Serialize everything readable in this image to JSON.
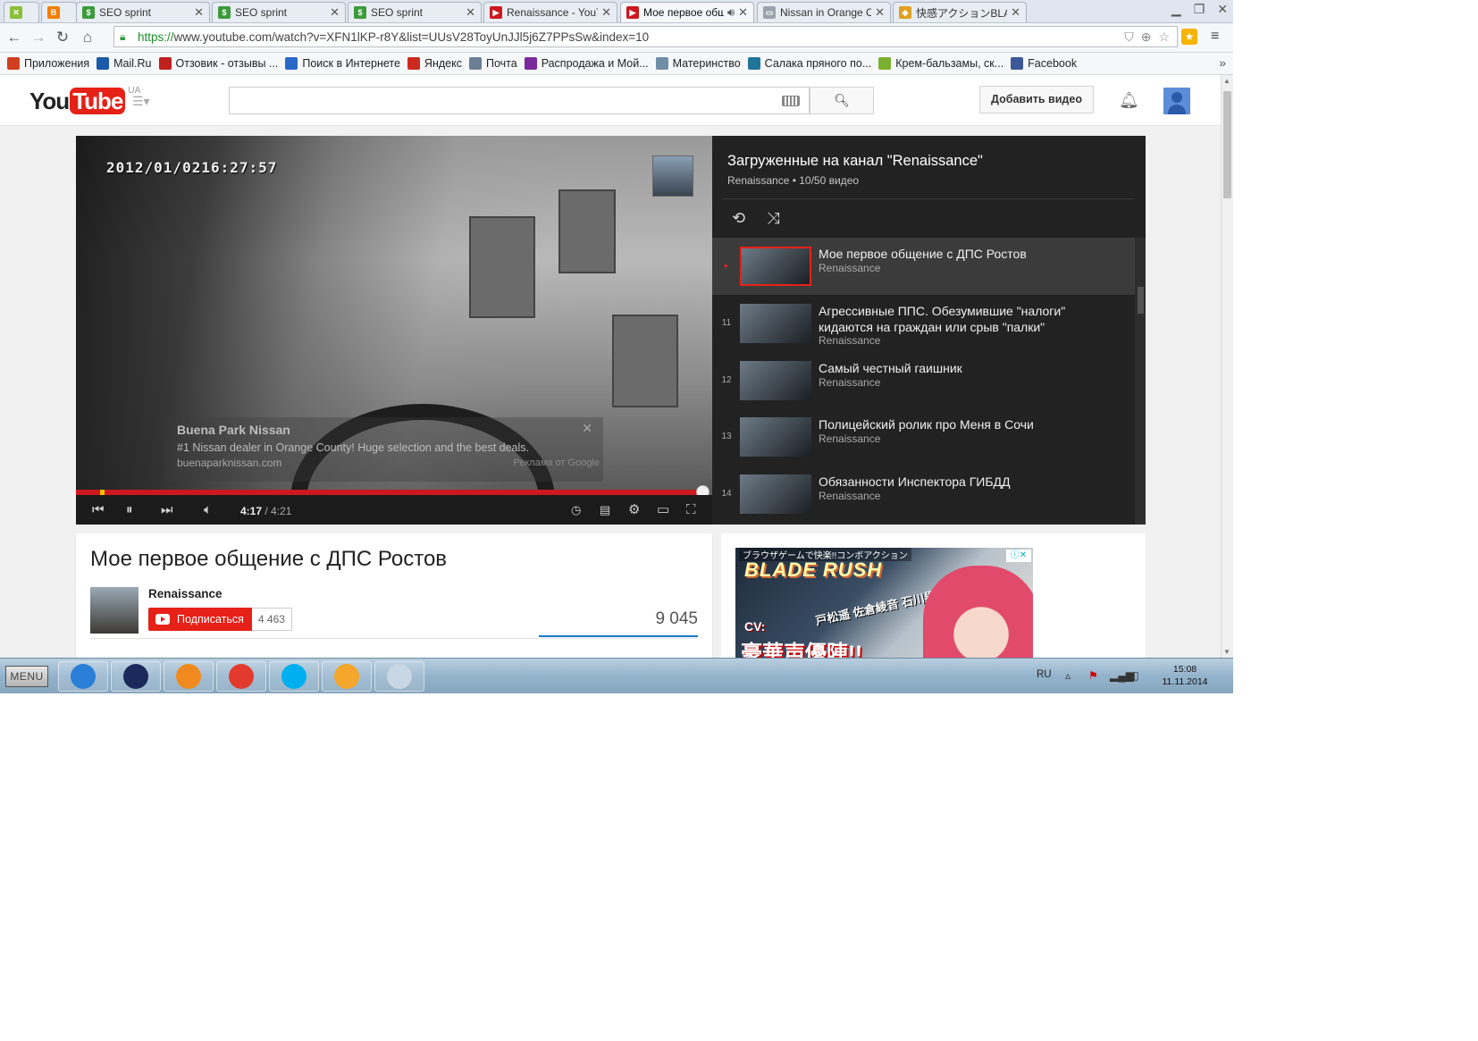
{
  "tabs": [
    {
      "title": "",
      "icon": "app-icon",
      "color": "#8bbf3a",
      "active": false
    },
    {
      "title": "",
      "icon": "blogger-icon",
      "color": "#f57d00",
      "active": false
    },
    {
      "title": "SEO sprint",
      "icon": "seosprint-icon",
      "color": "#3c9a3c",
      "active": false
    },
    {
      "title": "SEO sprint",
      "icon": "seosprint-icon",
      "color": "#3c9a3c",
      "active": false
    },
    {
      "title": "SEO sprint",
      "icon": "seosprint-icon",
      "color": "#3c9a3c",
      "active": false
    },
    {
      "title": "Renaissance - YouTu",
      "icon": "youtube-icon",
      "color": "#cc181e",
      "active": false
    },
    {
      "title": "Мое первое обш",
      "icon": "youtube-icon",
      "color": "#cc181e",
      "active": true,
      "audio": "speaker-icon"
    },
    {
      "title": "Nissan in Orange Co",
      "icon": "page-icon",
      "color": "#9aa3ad",
      "active": false
    },
    {
      "title": "快感アクションBLAD",
      "icon": "game-icon",
      "color": "#e0a020",
      "active": false
    }
  ],
  "browser": {
    "url_proto": "https://",
    "url_rest": "www.youtube.com/watch?v=XFN1lKP-r8Y&list=UUsV28ToyUnJJl5j6Z7PPsSw&index=10"
  },
  "bookmarks": [
    {
      "label": "Приложения",
      "icon": "apps-grid-icon",
      "color": "#d04020"
    },
    {
      "label": "Mail.Ru",
      "icon": "mailru-icon",
      "color": "#1a5aa8"
    },
    {
      "label": "Отзовик - отзывы ...",
      "icon": "otzovik-icon",
      "color": "#c02020"
    },
    {
      "label": "Поиск в Интернете",
      "icon": "search-icon",
      "color": "#2a68c8"
    },
    {
      "label": "Яндекс",
      "icon": "yandex-icon",
      "color": "#cc2a1e"
    },
    {
      "label": "Почта",
      "icon": "mail-icon",
      "color": "#6c7e96"
    },
    {
      "label": "Распродажа и Мой...",
      "icon": "sale-icon",
      "color": "#7a2a9a"
    },
    {
      "label": "Материнство",
      "icon": "mother-icon",
      "color": "#6f8ea8"
    },
    {
      "label": "Салака пряного по...",
      "icon": "wordpress-icon",
      "color": "#21759b"
    },
    {
      "label": "Крем-бальзамы, ск...",
      "icon": "leaf-icon",
      "color": "#7ab030"
    },
    {
      "label": "Facebook",
      "icon": "facebook-icon",
      "color": "#3b5998"
    }
  ],
  "yt": {
    "logo_you": "You",
    "logo_tube": "Tube",
    "region": "UA",
    "search_placeholder": "",
    "upload_label": "Добавить видео"
  },
  "player": {
    "timestamp": "2012/01/0216:27:57",
    "current_time": "4:17",
    "separator": " / ",
    "duration": "4:21",
    "played_fraction": 0.984,
    "ad": {
      "title": "Buena Park Nissan",
      "description": "#1 Nissan dealer in Orange County! Huge selection and the best deals.",
      "url": "buenaparknissan.com",
      "attribution": "Реклама от Google",
      "close": "✕"
    }
  },
  "playlist": {
    "title": "Загруженные на канал \"Renaissance\"",
    "subtitle": "Renaissance • 10/50 видео",
    "items": [
      {
        "index": "▸",
        "title": "Мое первое общение с ДПС Ростов",
        "owner": "Renaissance",
        "active": true
      },
      {
        "index": "11",
        "title": "Агрессивные ППС. Обезумившие \"налоги\" кидаются на граждан или срыв \"палки\"",
        "owner": "Renaissance",
        "active": false
      },
      {
        "index": "12",
        "title": "Самый честный гаишник",
        "owner": "Renaissance",
        "active": false
      },
      {
        "index": "13",
        "title": "Полицейский ролик про Меня в Сочи",
        "owner": "Renaissance",
        "active": false
      },
      {
        "index": "14",
        "title": "Обязанности Инспектора ГИБДД",
        "owner": "Renaissance",
        "active": false
      }
    ]
  },
  "video": {
    "title": "Мое первое общение с ДПС Ростов",
    "owner": "Renaissance",
    "subscribe_label": "Подписаться",
    "subscriber_count": "4 463",
    "view_count": "9 045"
  },
  "ad_banner": {
    "top_line": "ブラウザゲームで快楽!!コンボアクション",
    "brand": "BLADE RUSH",
    "names": "戸松遥 佐倉綾音 石川界人",
    "cast": "CV:",
    "catch": "豪華声優陣!!"
  },
  "taskbar": {
    "start_label": "MENU",
    "apps": [
      {
        "name": "ie-icon",
        "color": "#2a7fd8"
      },
      {
        "name": "monitor-icon",
        "color": "#1b2a5a"
      },
      {
        "name": "media-player-icon",
        "color": "#f08a1e"
      },
      {
        "name": "chrome-icon",
        "color": "#e23b2e"
      },
      {
        "name": "skype-icon",
        "color": "#00aff0"
      },
      {
        "name": "icq-icon",
        "color": "#f4a72a"
      },
      {
        "name": "paint-icon",
        "color": "#c9d7e4"
      }
    ],
    "language": "RU",
    "time": "15:08",
    "date": "11.11.2014"
  }
}
